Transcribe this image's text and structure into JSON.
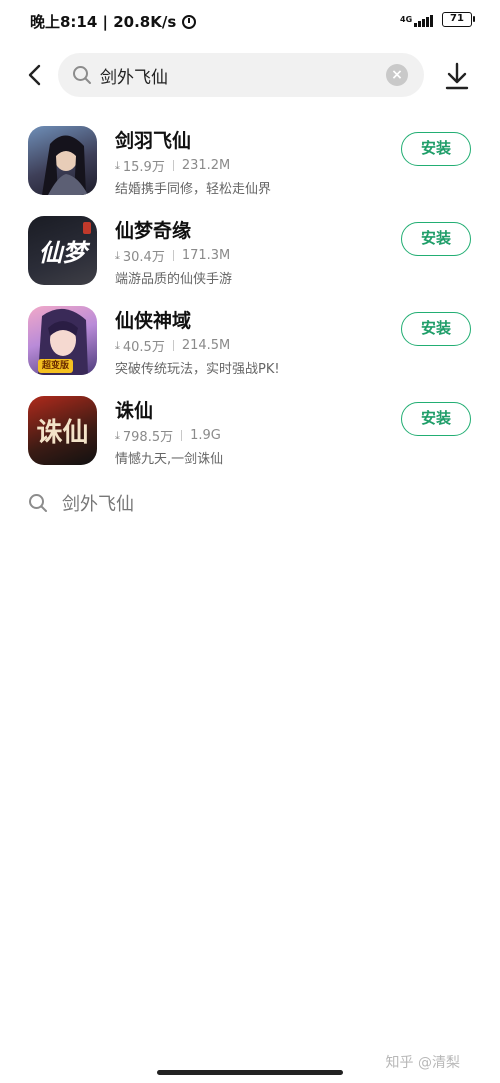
{
  "status_bar": {
    "time_and_speed": "晚上8:14 | 20.8K/s",
    "network": "4G",
    "battery": "71"
  },
  "search": {
    "query": "剑外飞仙",
    "clear_label": "×"
  },
  "results": [
    {
      "name": "剑羽飞仙",
      "downloads": "15.9万",
      "size": "231.2M",
      "description": "结婚携手同修，轻松走仙界",
      "install_label": "安装",
      "icon_text": ""
    },
    {
      "name": "仙梦奇缘",
      "downloads": "30.4万",
      "size": "171.3M",
      "description": "端游品质的仙侠手游",
      "install_label": "安装",
      "icon_text": "仙梦"
    },
    {
      "name": "仙侠神域",
      "downloads": "40.5万",
      "size": "214.5M",
      "description": "突破传统玩法，实时强战PK!",
      "install_label": "安装",
      "icon_text": "超变版"
    },
    {
      "name": "诛仙",
      "downloads": "798.5万",
      "size": "1.9G",
      "description": "情憾九天,一剑诛仙",
      "install_label": "安装",
      "icon_text": "诛仙"
    }
  ],
  "suggestion": {
    "label": "剑外飞仙"
  },
  "footer": {
    "watermark": "知乎 @清梨"
  },
  "colors": {
    "accent": "#1f9e69",
    "search_bg": "#f1f1f1"
  }
}
